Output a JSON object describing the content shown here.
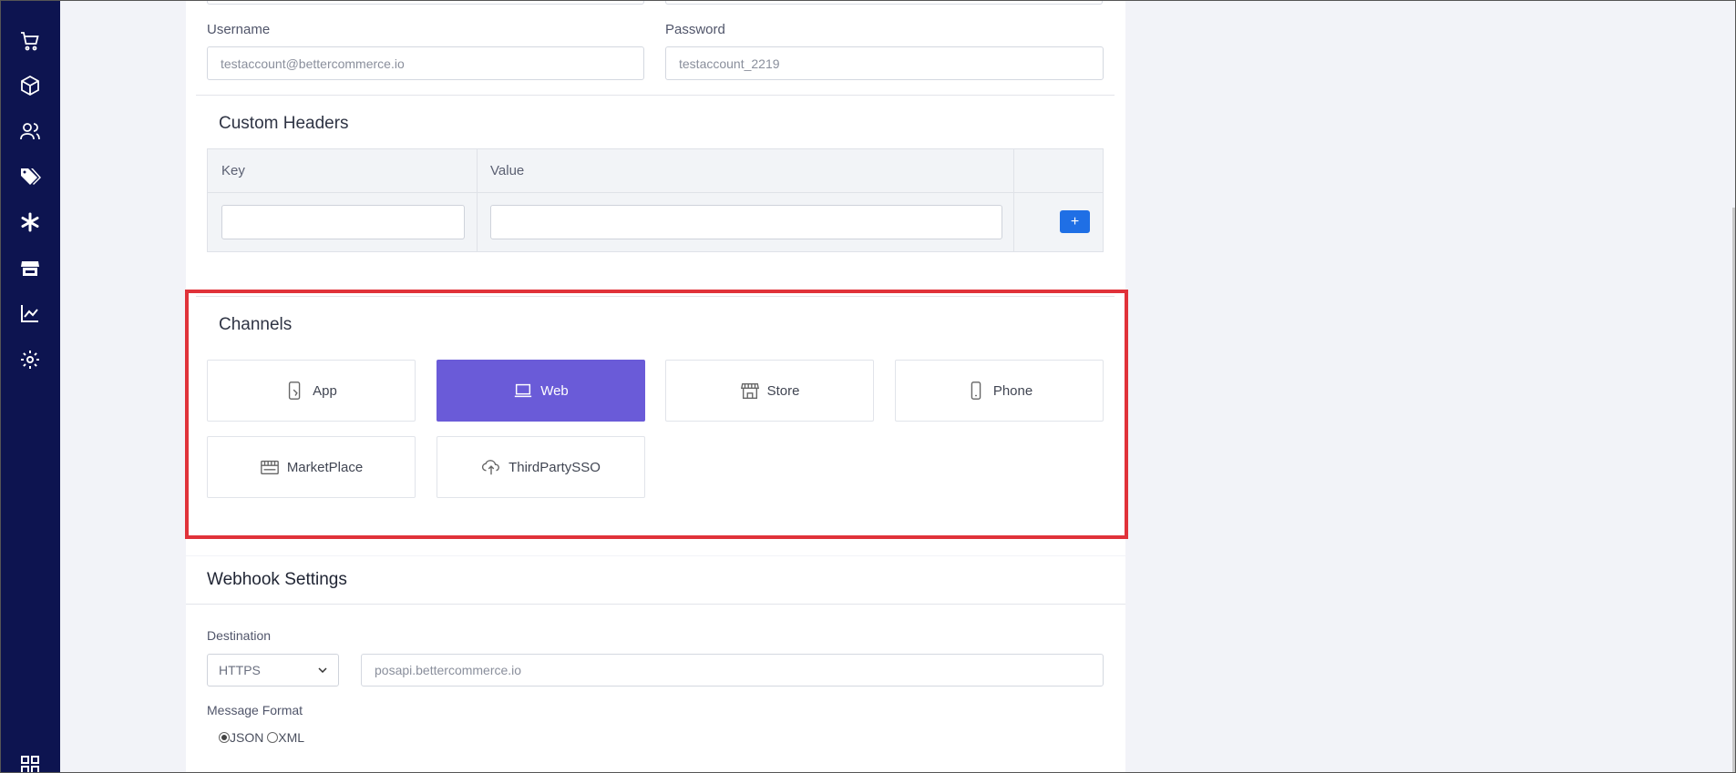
{
  "sidebar": {
    "icons": [
      "cart-icon",
      "box-icon",
      "users-icon",
      "tags-icon",
      "asterisk-icon",
      "store-icon",
      "chart-icon",
      "gear-icon",
      "apps-grid-icon"
    ]
  },
  "credentials": {
    "username_label": "Username",
    "username_value": "testaccount@bettercommerce.io",
    "password_label": "Password",
    "password_value": "testaccount_2219"
  },
  "custom_headers": {
    "title": "Custom Headers",
    "columns": [
      "Key",
      "Value",
      ""
    ],
    "add_label": "+"
  },
  "channels": {
    "title": "Channels",
    "items": [
      {
        "label": "App",
        "icon": "mobile-app-icon",
        "selected": false
      },
      {
        "label": "Web",
        "icon": "laptop-icon",
        "selected": true
      },
      {
        "label": "Store",
        "icon": "storefront-icon",
        "selected": false
      },
      {
        "label": "Phone",
        "icon": "phone-icon",
        "selected": false
      },
      {
        "label": "MarketPlace",
        "icon": "marketplace-icon",
        "selected": false
      },
      {
        "label": "ThirdPartySSO",
        "icon": "cloud-icon",
        "selected": false
      }
    ]
  },
  "webhook": {
    "title": "Webhook Settings",
    "destination_label": "Destination",
    "protocol_value": "HTTPS",
    "url_value": "posapi.bettercommerce.io",
    "format_label": "Message Format",
    "format_options": [
      "JSON",
      "XML"
    ],
    "format_selected": "JSON"
  },
  "colors": {
    "sidebar": "#0d1450",
    "channel_active": "#6a5bd8",
    "add_button": "#1f6fe5",
    "highlight_border": "#e0323a"
  }
}
